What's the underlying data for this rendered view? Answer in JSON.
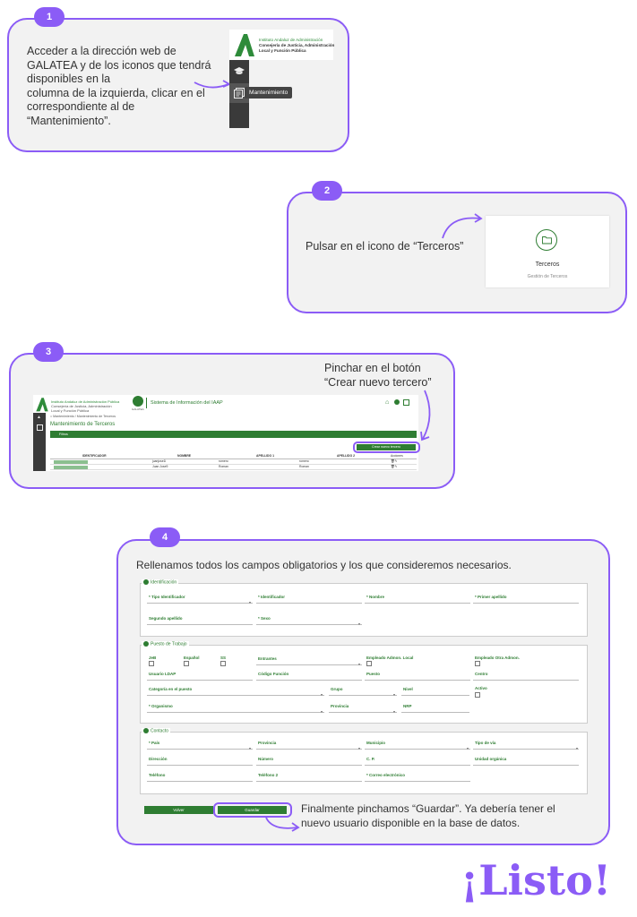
{
  "step1": {
    "number": "1",
    "text_lines": [
      "Acceder a la dirección web de",
      "GALATEA y de los iconos que tendrá",
      "disponibles en la",
      "columna de la izquierda, clicar en el",
      "correspondiente al de",
      "“Mantenimiento”."
    ],
    "logo_org_line1": "Instituto Andaluz de Administración",
    "logo_org_line2": "Consejería de Justicia, Administración",
    "logo_org_line3": "Local y Función Pública",
    "tooltip": "Mantenimiento",
    "icons": [
      "graduation-cap-icon",
      "document-list-icon"
    ]
  },
  "step2": {
    "number": "2",
    "text": "Pulsar en el icono de “Terceros”",
    "tile_title": "Terceros",
    "tile_subtitle": "Gestión de Terceros",
    "icon": "folder-icon"
  },
  "step3": {
    "number": "3",
    "text_line1": "Pinchar en el botón",
    "text_line2": "“Crear nuevo tercero”",
    "org_line1": "Instituto Andaluz de Administración Pública",
    "org_line2": "Consejería de Justicia, Administración",
    "org_line3": "Local y Función Pública",
    "app_logo": "GALATEA",
    "system_title": "Sistema de Información del IAAP",
    "breadcrumb": "Mantenimiento / Mantenimiento de Terceros",
    "page_title": "Mantenimiento de Terceros",
    "filter_label": "Filtros",
    "create_button": "Crear nuevo tercero",
    "table_headers": [
      "IDENTIFICADOR",
      "NOMBRE",
      "APELLIDO 1",
      "APELLIDO 2",
      "Acciones"
    ],
    "rows": [
      {
        "id": "",
        "nombre": "juanjose1l",
        "apellido1": "romero",
        "apellido2": "romero"
      },
      {
        "id": "",
        "nombre": "Juan Jose9",
        "apellido1": "Roman",
        "apellido2": "Roman"
      }
    ]
  },
  "step4": {
    "number": "4",
    "title": "Rellenamos todos los campos obligatorios y los que consideremos necesarios.",
    "sections": {
      "identificacion": {
        "title": "Identificación",
        "fields": [
          "* Tipo Identificador",
          "* Identificador",
          "* Nombre",
          "* Primer apellido",
          "Segundo apellido",
          "* Sexo"
        ]
      },
      "puesto": {
        "title": "Puesto de Trabajo",
        "checks": [
          "JeB",
          "Español",
          "SS"
        ],
        "fields": [
          "Entrantes",
          "Empleado Admon. Local",
          "Empleado Otra Admon.",
          "Usuario LDAP",
          "Código Función",
          "Puesto",
          "Centro",
          "Categoría en el puesto",
          "Grupo",
          "Nivel",
          "Activo",
          "* Organismo",
          "Provincia",
          "NRP"
        ]
      },
      "contacto": {
        "title": "Contacto",
        "fields": [
          "* País",
          "Provincia",
          "Municipio",
          "Tipo de vía",
          "Dirección",
          "Número",
          "C. P.",
          "Unidad orgánica",
          "Teléfono",
          "Teléfono 2",
          "* Correo electrónico"
        ]
      }
    },
    "back_button": "Volver",
    "save_button": "Guardar",
    "final_line1": "Finalmente pinchamos “Guardar”. Ya debería tener el",
    "final_line2": "nuevo usuario disponible en la base de datos."
  },
  "done_text": "¡Listo!",
  "colors": {
    "accent": "#8b5cf6",
    "green": "#2e7d32",
    "done": "#8b5cf6"
  }
}
